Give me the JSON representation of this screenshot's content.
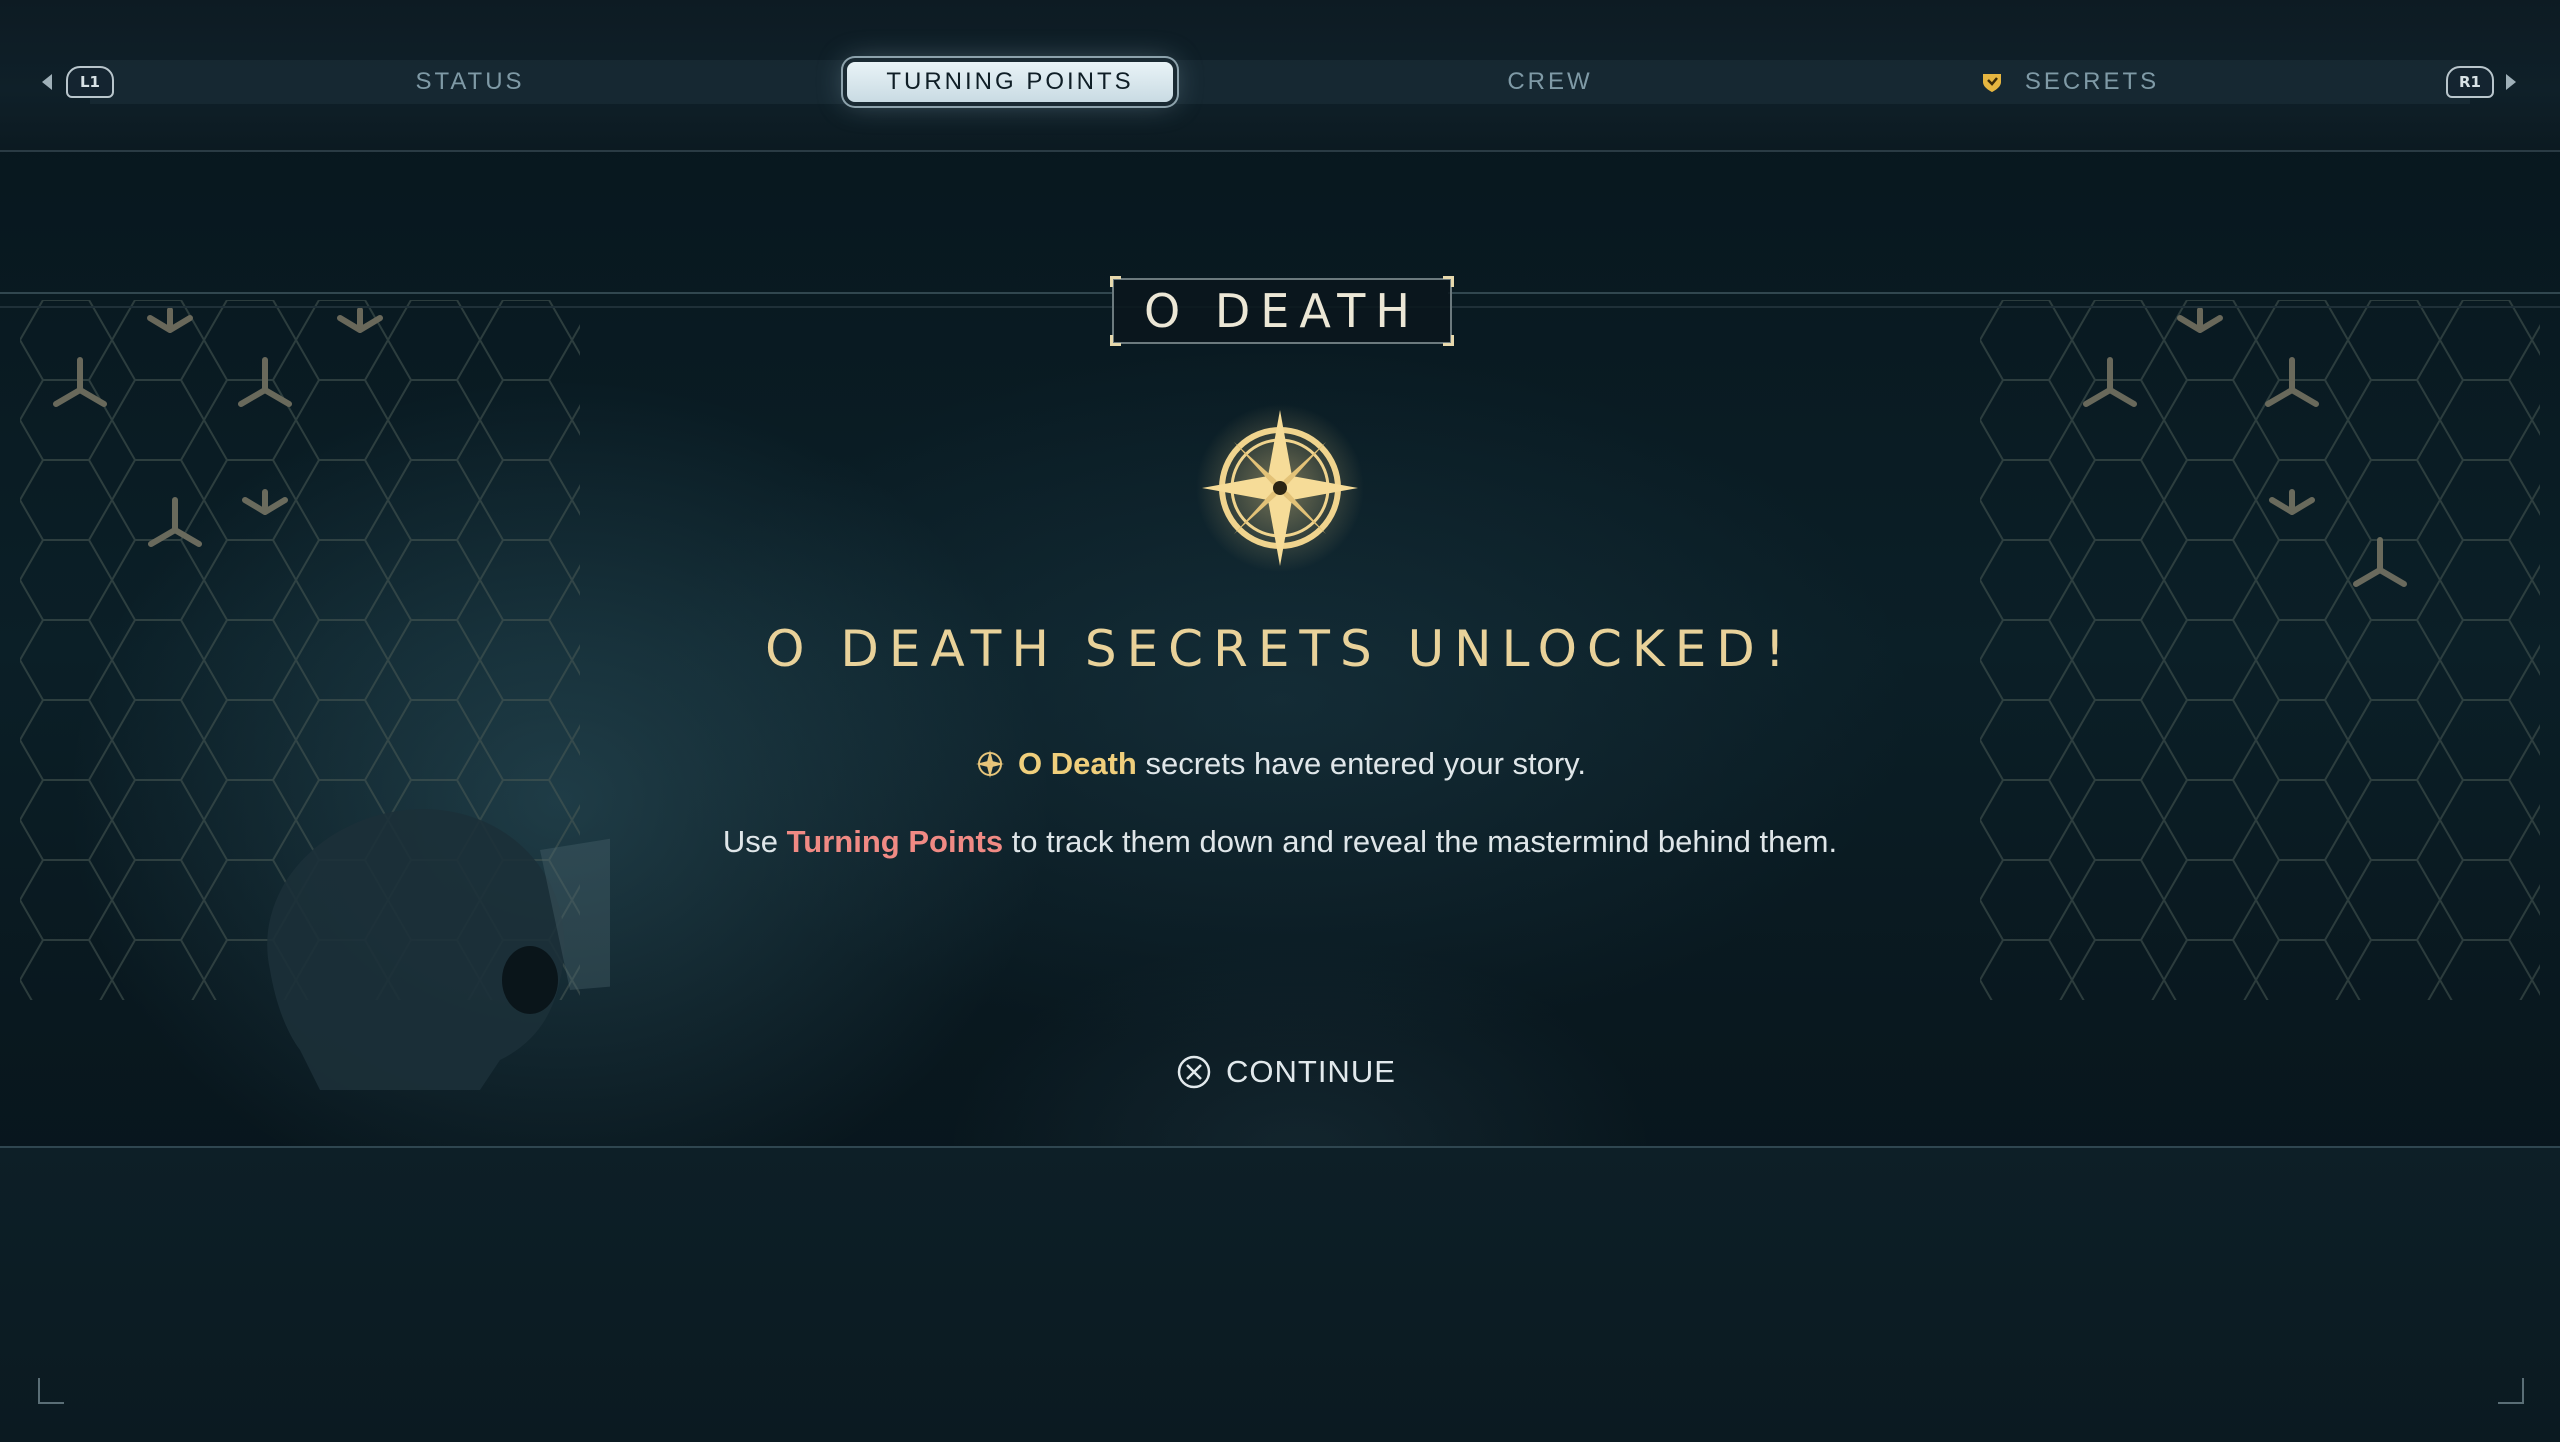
{
  "nav": {
    "left_button": "L1",
    "right_button": "R1",
    "tabs": [
      {
        "label": "STATUS"
      },
      {
        "label": "TURNING POINTS"
      },
      {
        "label": "CREW"
      },
      {
        "label": "SECRETS"
      }
    ],
    "active_tab": "TURNING POINTS"
  },
  "panel": {
    "title": "O DEATH",
    "headline": "O DEATH SECRETS UNLOCKED!",
    "line1": {
      "highlight": "O Death",
      "rest": " secrets have entered your story."
    },
    "line2": {
      "prefix": "Use ",
      "highlight": "Turning Points",
      "suffix": " to track them down and reveal the mastermind behind them."
    },
    "continue_label": "CONTINUE"
  },
  "colors": {
    "gold": "#f0cf7c",
    "highlight_red": "#f08a84",
    "headline": "#e9d29a"
  },
  "icons": {
    "compass": "compass-rose-icon",
    "continue": "cross-button-icon",
    "secrets": "shield-icon"
  }
}
